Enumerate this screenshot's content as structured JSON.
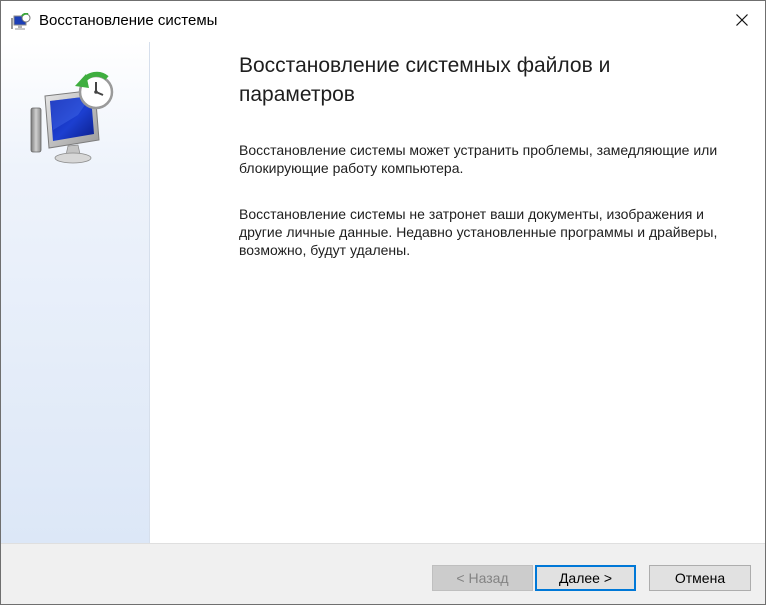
{
  "window": {
    "title": "Восстановление системы",
    "title_icon": "system-restore-icon",
    "close_icon": "close-icon"
  },
  "sidebar": {
    "icon": "system-restore-icon"
  },
  "main": {
    "heading": "Восстановление системных файлов и параметров",
    "paragraph1": "Восстановление системы может устранить проблемы, замедляющие или блокирующие работу компьютера.",
    "paragraph2": "Восстановление системы не затронет ваши документы, изображения и другие личные данные. Недавно установленные программы и драйверы, возможно, будут удалены."
  },
  "buttons": {
    "back_label": "< Назад",
    "next_label": "Далее >",
    "cancel_label": "Отмена",
    "back_enabled": false
  },
  "colors": {
    "accent": "#0078d7",
    "sidebar_gradient_end": "#dce7f7",
    "footer_bg": "#f0f0f0",
    "disabled_text": "#838383"
  }
}
